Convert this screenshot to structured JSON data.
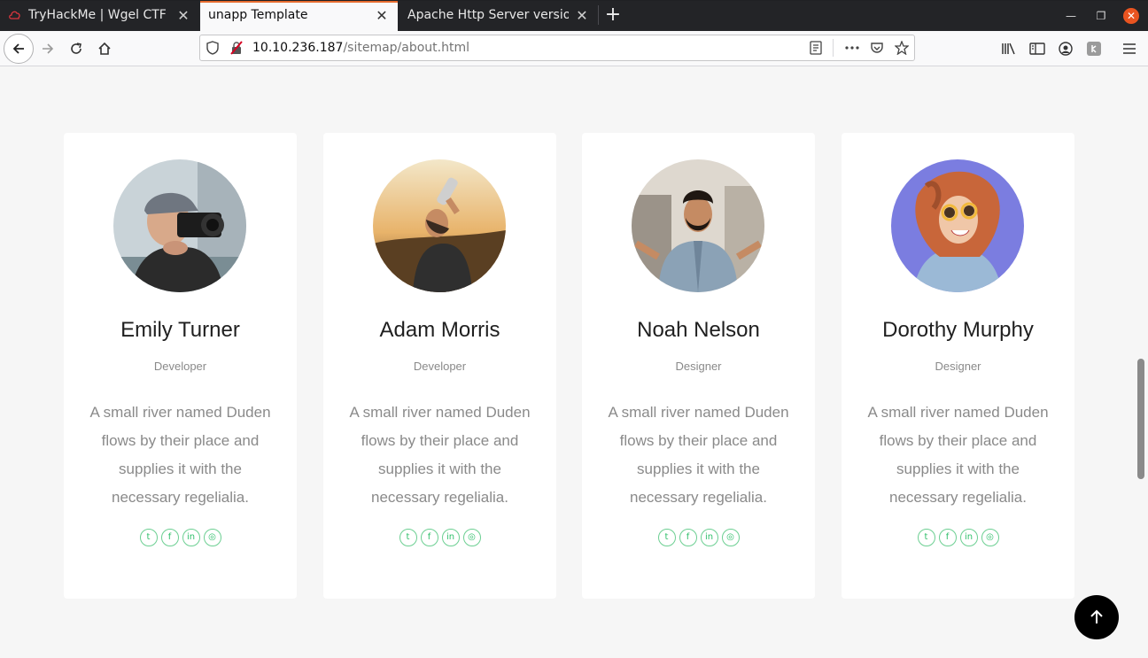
{
  "browser": {
    "tabs": [
      {
        "label": "TryHackMe | Wgel CTF",
        "active": false
      },
      {
        "label": "unapp Template",
        "active": true
      },
      {
        "label": "Apache Http Server version",
        "active": false
      }
    ],
    "url_host": "10.10.236.187",
    "url_path": "/sitemap/about.html"
  },
  "team": [
    {
      "name": "Emily Turner",
      "role": "Developer",
      "description": "A small river named Duden flows by their place and supplies it with the necessary regelialia."
    },
    {
      "name": "Adam Morris",
      "role": "Developer",
      "description": "A small river named Duden flows by their place and supplies it with the necessary regelialia."
    },
    {
      "name": "Noah Nelson",
      "role": "Designer",
      "description": "A small river named Duden flows by their place and supplies it with the necessary regelialia."
    },
    {
      "name": "Dorothy Murphy",
      "role": "Designer",
      "description": "A small river named Duden flows by their place and supplies it with the necessary regelialia."
    }
  ],
  "social_icons": [
    "twitter-icon",
    "facebook-icon",
    "linkedin-icon",
    "dribbble-icon"
  ],
  "colors": {
    "accent": "#2fbf6a",
    "tab_accent": "#e66b2e",
    "window_close": "#e95420"
  }
}
